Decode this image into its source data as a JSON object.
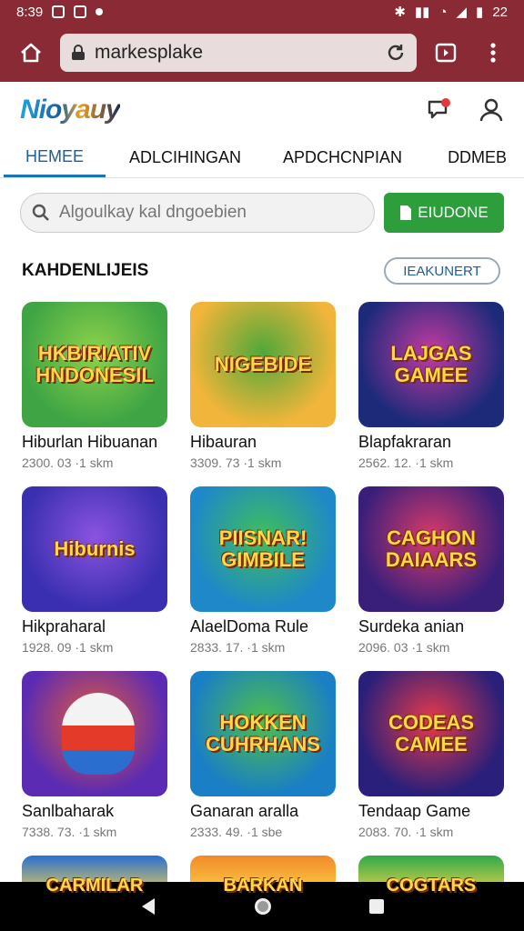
{
  "status_bar": {
    "time": "8:39",
    "battery": "22"
  },
  "browser": {
    "url": "markesplake"
  },
  "header": {
    "logo": "Nioyauy"
  },
  "tabs": [
    "HEMEE",
    "ADLCIHINGAN",
    "APDCHCNPIAN",
    "DDMEB"
  ],
  "search": {
    "placeholder": "Algoulkay kal dngoebien",
    "button_label": "EIUDONE"
  },
  "section": {
    "title": "KAHDENLIJEIS",
    "more_label": "IEAKUNERT"
  },
  "cards": [
    {
      "title": "Hiburlan Hibuanan",
      "meta": "2300. 03 ·1 skm",
      "art_text": "HKBIRIATIV HNDONESIL",
      "art_bg": "#3fa544",
      "art_bg2": "#8dd24b"
    },
    {
      "title": "Hibauran",
      "meta": "3309. 73 ·1 skm",
      "art_text": "NIGEBIDE",
      "art_bg": "#f0b53a",
      "art_bg2": "#4fa83a"
    },
    {
      "title": "Blapfakraran",
      "meta": "2562. 12. ·1 skm",
      "art_text": "LAJGAS GAMEE",
      "art_bg": "#1d2a7a",
      "art_bg2": "#c43aa0"
    },
    {
      "title": "Hikpraharal",
      "meta": "1928. 09 ·1 skm",
      "art_text": "Hiburnis",
      "art_bg": "#3a2fb0",
      "art_bg2": "#8a53e0"
    },
    {
      "title": "AlaelDoma Rule",
      "meta": "2833. 17. ·1 skm",
      "art_text": "PIISNAR! GIMBILE",
      "art_bg": "#1e88c9",
      "art_bg2": "#3fbf5a"
    },
    {
      "title": "Surdeka anian",
      "meta": "2096. 03 ·1 skm",
      "art_text": "CAGHON DAIAARS",
      "art_bg": "#3a1f7a",
      "art_bg2": "#d93a6b"
    },
    {
      "title": "Sanlbaharak",
      "meta": "7338. 73. ·1 skm",
      "art_text": "",
      "art_bg": "#5b2bb3",
      "art_bg2": "#e85a3a"
    },
    {
      "title": "Ganaran aralla",
      "meta": "2333. 49. ·1 sbe",
      "art_text": "HOKKEN CUHRHANS",
      "art_bg": "#1a7fc4",
      "art_bg2": "#4fbf4a"
    },
    {
      "title": "Tendaap Game",
      "meta": "2083. 70. ·1 skm",
      "art_text": "CODEAS CAMEE",
      "art_bg": "#2a1f7a",
      "art_bg2": "#e83a4a"
    }
  ],
  "partial_cards": [
    {
      "art_text": "CARMILAR",
      "art_bg": "#2a6fd0"
    },
    {
      "art_text": "BARKAN",
      "art_bg": "#f08a2a"
    },
    {
      "art_text": "COGTARS",
      "art_bg": "#2fa84a"
    }
  ]
}
